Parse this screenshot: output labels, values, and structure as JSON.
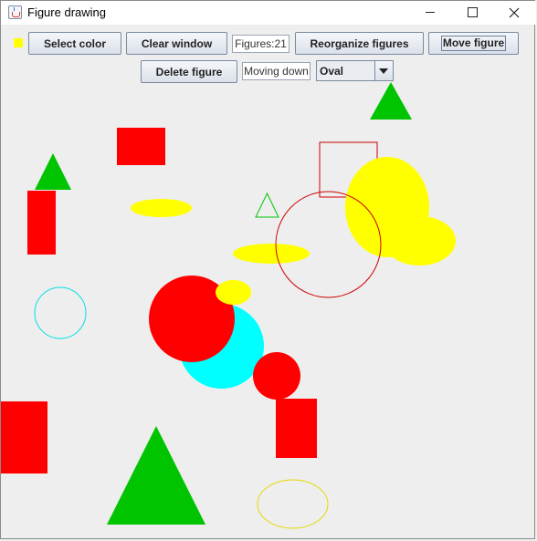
{
  "window": {
    "title": "Figure drawing"
  },
  "toolbar": {
    "selected_color": "#ffff00",
    "select_color_label": "Select color",
    "clear_window_label": "Clear window",
    "figures_count_text": "Figures:21",
    "reorganize_label": "Reorganize figures",
    "move_figure_label": "Move figure",
    "delete_figure_label": "Delete figure",
    "moving_status_text": "Moving down",
    "figure_type_selected": "Oval"
  },
  "figures": [
    {
      "type": "rect",
      "filled": true,
      "color": "#ff0000"
    },
    {
      "type": "rect",
      "filled": false,
      "color": "#cc0000"
    },
    {
      "type": "rect",
      "filled": true,
      "color": "#ff0000"
    },
    {
      "type": "rect",
      "filled": true,
      "color": "#ff0000"
    },
    {
      "type": "rect",
      "filled": true,
      "color": "#ff0000"
    },
    {
      "type": "triangle",
      "filled": true,
      "color": "#00c400"
    },
    {
      "type": "triangle",
      "filled": true,
      "color": "#00c400"
    },
    {
      "type": "triangle",
      "filled": false,
      "color": "#00c400"
    },
    {
      "type": "triangle",
      "filled": true,
      "color": "#00c400"
    },
    {
      "type": "oval",
      "filled": true,
      "color": "#ffff00"
    },
    {
      "type": "oval",
      "filled": true,
      "color": "#ffff00"
    },
    {
      "type": "oval",
      "filled": true,
      "color": "#ffff00"
    },
    {
      "type": "oval",
      "filled": true,
      "color": "#ffff00"
    },
    {
      "type": "oval",
      "filled": true,
      "color": "#ffff00"
    },
    {
      "type": "oval",
      "filled": false,
      "color": "#e6d800"
    },
    {
      "type": "oval",
      "filled": false,
      "color": "#cc0000"
    },
    {
      "type": "oval",
      "filled": false,
      "color": "#00e0e0"
    },
    {
      "type": "oval",
      "filled": true,
      "color": "#00ffff"
    },
    {
      "type": "oval",
      "filled": true,
      "color": "#ff0000"
    },
    {
      "type": "oval",
      "filled": true,
      "color": "#ff0000"
    },
    {
      "type": "oval",
      "filled": true,
      "color": "#ffff00"
    }
  ]
}
